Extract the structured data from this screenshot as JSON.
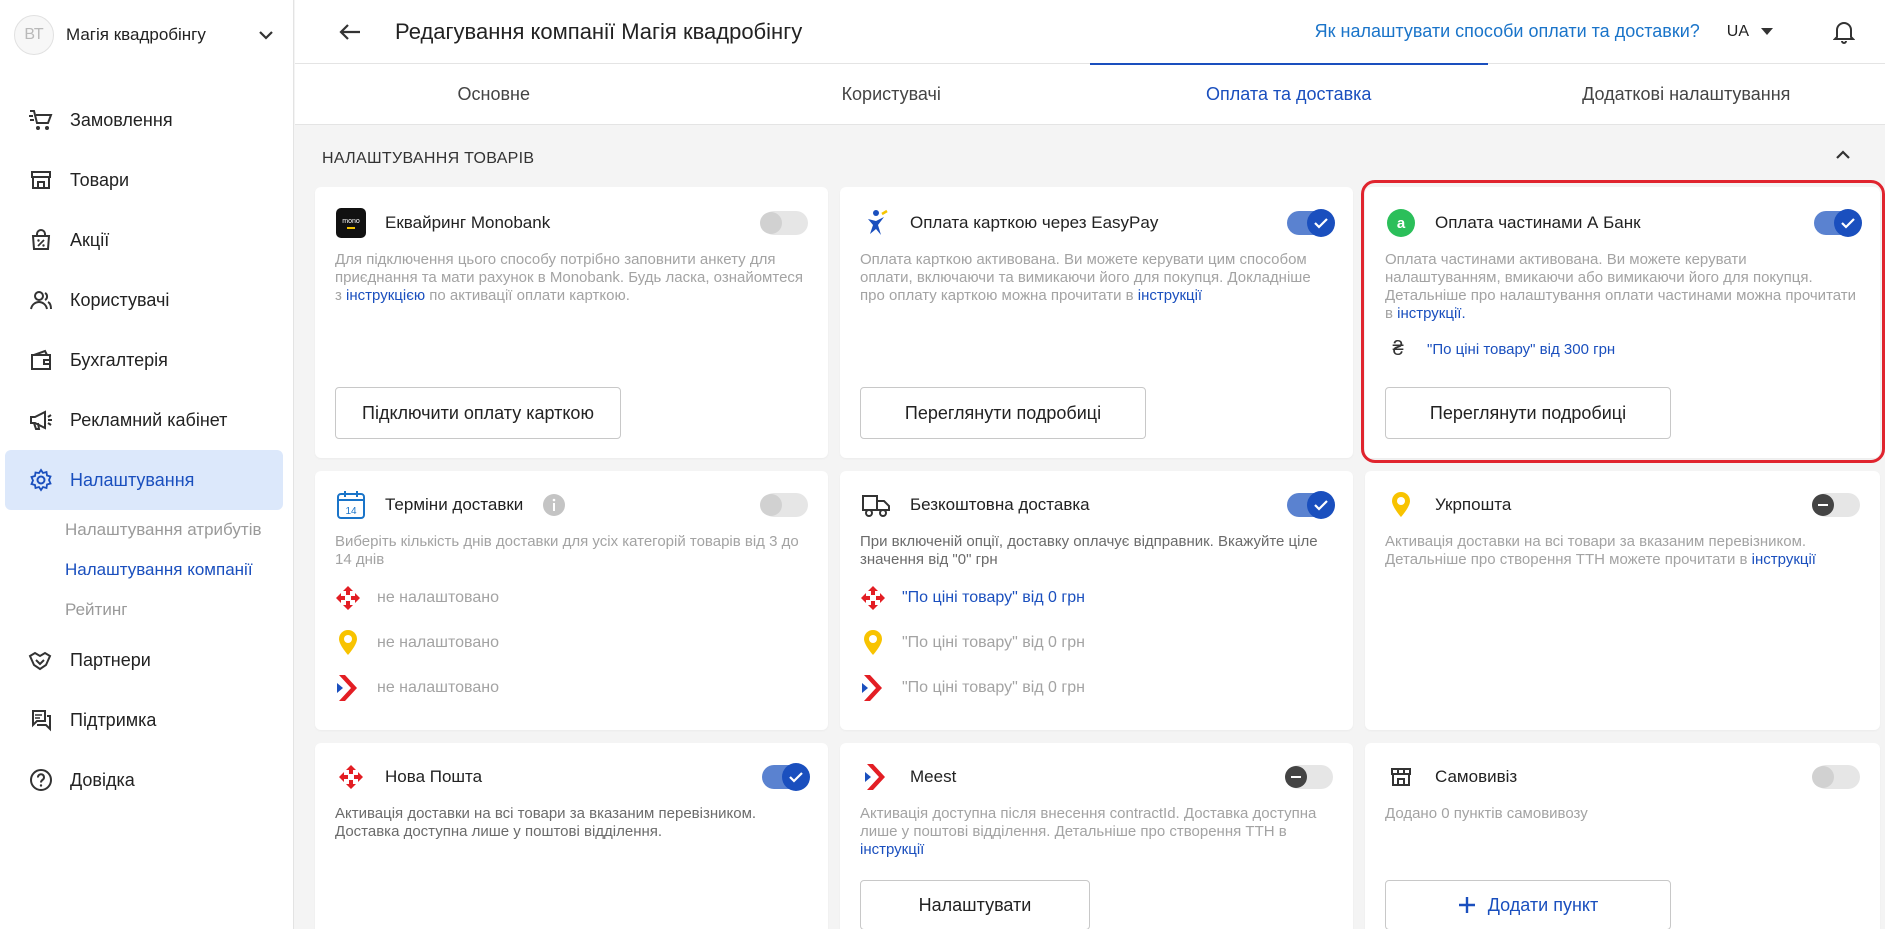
{
  "sidebar": {
    "avatar_initials": "ВТ",
    "company_name": "Магія квадробінгу",
    "items": [
      {
        "label": "Замовлення",
        "icon": "cart-icon"
      },
      {
        "label": "Товари",
        "icon": "store-icon"
      },
      {
        "label": "Акції",
        "icon": "promo-bag-icon"
      },
      {
        "label": "Користувачі",
        "icon": "users-icon"
      },
      {
        "label": "Бухгалтерія",
        "icon": "wallet-icon"
      },
      {
        "label": "Рекламний кабінет",
        "icon": "megaphone-icon"
      },
      {
        "label": "Налаштування",
        "icon": "gear-icon"
      },
      {
        "label": "Партнери",
        "icon": "handshake-icon"
      },
      {
        "label": "Підтримка",
        "icon": "chat-icon"
      },
      {
        "label": "Довідка",
        "icon": "question-icon"
      }
    ],
    "sub_items": [
      {
        "label": "Налаштування атрибутів"
      },
      {
        "label": "Налаштування компанії"
      },
      {
        "label": "Рейтинг"
      }
    ]
  },
  "header": {
    "title": "Редагування компанії Магія квадробінгу",
    "help_link": "Як налаштувати способи оплати та доставки?",
    "lang": "UA"
  },
  "tabs": [
    {
      "label": "Основне"
    },
    {
      "label": "Користувачі"
    },
    {
      "label": "Оплата та доставка"
    },
    {
      "label": "Додаткові налаштування"
    }
  ],
  "section": {
    "title": "НАЛАШТУВАННЯ ТОВАРІВ"
  },
  "cards": {
    "monobank": {
      "title": "Еквайринг Monobank",
      "icon_text": "mono",
      "desc_before": "Для підключення цього способу потрібно заповнити анкету для приєднання та мати рахунок в Monobank. Будь ласка, ознайомтеся з ",
      "link": "інструкцією",
      "desc_after": " по активації оплати карткою.",
      "button": "Підключити оплату карткою",
      "enabled": false
    },
    "easypay": {
      "title": "Оплата карткою через EasyPay",
      "desc_before": "Оплата карткою активована. Ви можете керувати цим способом оплати, включаючи та вимикаючи його для покупця. Докладніше про оплату карткою можна прочитати в ",
      "link": "інструкції",
      "button": "Переглянути подробиці",
      "enabled": true
    },
    "abank": {
      "title": "Оплата частинами А Банк",
      "icon_text": "а",
      "desc_before": "Оплата частинами активована. Ви можете керувати налаштуванням, вмикаючи або вимикаючи його для покупця. Детальніше про налаштування оплати частинами можна прочитати в ",
      "link": "інструкції.",
      "price_rule": "\"По ціні товару\" від 300 грн",
      "currency_symbol": "₴",
      "button": "Переглянути подробиці",
      "enabled": true
    },
    "delivery_terms": {
      "title": "Терміни доставки",
      "calendar_day": "14",
      "desc": "Виберіть кількість днів доставки для усіх категорій товарів від 3 до 14 днів",
      "rows": [
        "не налаштовано",
        "не налаштовано",
        "не налаштовано"
      ],
      "enabled": false
    },
    "free_delivery": {
      "title": "Безкоштовна доставка",
      "desc": "При включеній опції, доставку оплачує відправник. Вкажуйте ціле значення від \"0\" грн",
      "rows": [
        "\"По ціні товару\" від 0 грн",
        "\"По ціні товару\" від 0 грн",
        "\"По ціні товару\" від 0 грн"
      ],
      "enabled": true
    },
    "ukrposhta": {
      "title": "Укрпошта",
      "desc_before": "Активація доставки на всі товари за вказаним перевізником. Детальніше про створення ТТН можете прочитати в ",
      "link": "інструкції",
      "enabled": false
    },
    "novaposhta": {
      "title": "Нова Пошта",
      "desc": "Активація доставки на всі товари за вказаним перевізником. Доставка доступна лише у поштові відділення.",
      "enabled": true
    },
    "meest": {
      "title": "Meest",
      "desc_before": "Активація доступна після внесення contractId. Доставка доступна лише у поштові відділення. Детальніше про створення ТТН в ",
      "link": "інструкції",
      "button": "Налаштувати",
      "enabled": false
    },
    "pickup": {
      "title": "Самовивіз",
      "desc": "Додано 0 пунктів самовивозу",
      "button": "Додати пункт",
      "enabled": false
    }
  },
  "colors": {
    "accent": "#1a4fbe",
    "highlight": "#e0242e",
    "link": "#1a74c9"
  }
}
